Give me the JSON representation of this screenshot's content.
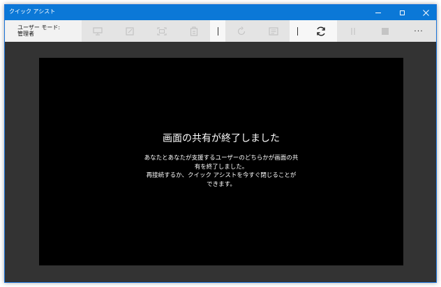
{
  "window": {
    "title": "クイック アシスト",
    "accent_color": "#0b78d7",
    "controls": [
      "minimize-icon",
      "maximize-icon",
      "close-icon"
    ]
  },
  "toolbar": {
    "mode_label": "ユーザー モード:",
    "mode_value": "管理者",
    "more_label": "···",
    "buttons": [
      {
        "icon": "monitor-icon",
        "enabled": false
      },
      {
        "icon": "annotate-icon",
        "enabled": false
      },
      {
        "icon": "fit-screen-icon",
        "enabled": false
      },
      {
        "icon": "task-manager-icon",
        "enabled": false
      },
      {
        "icon": "separator",
        "enabled": false
      },
      {
        "icon": "restart-icon",
        "enabled": false
      },
      {
        "icon": "instruction-channel-icon",
        "enabled": false
      },
      {
        "icon": "separator",
        "enabled": false
      },
      {
        "icon": "reconnect-icon",
        "enabled": true
      },
      {
        "icon": "pause-icon",
        "enabled": false
      },
      {
        "icon": "stop-icon",
        "enabled": false
      },
      {
        "icon": "more-icon",
        "enabled": true
      }
    ]
  },
  "message": {
    "title": "画面の共有が終了しました",
    "line1": "あなたとあなたが支援するユーザーのどちらかが画面の共",
    "line2": "有を終了しました。",
    "line3": "再接続するか、クイック アシストを今すぐ閉じることが",
    "line4": "できます。"
  }
}
